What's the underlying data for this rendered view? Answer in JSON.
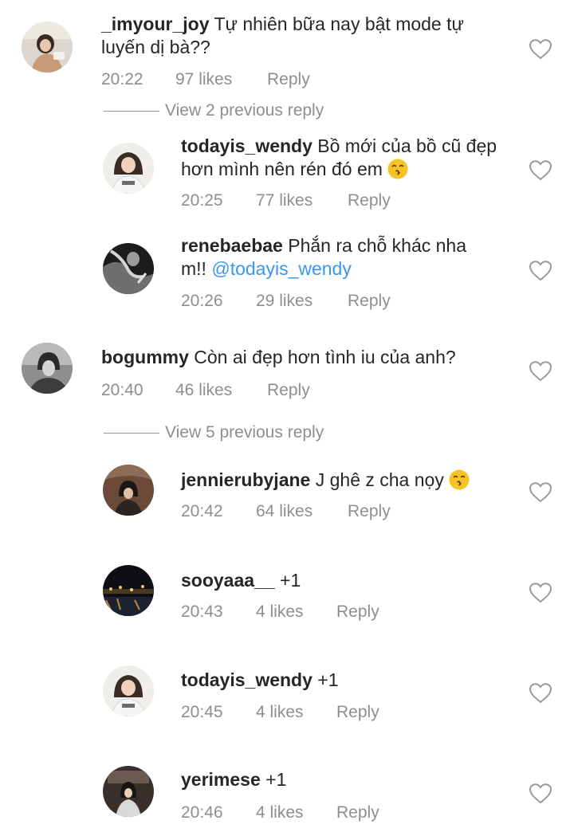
{
  "comments": [
    {
      "username": "_imyour_joy",
      "text": "Tự nhiên bữa nay bật mode tự",
      "text2": "luyến dị bà??",
      "time": "20:22",
      "likes": "97 likes",
      "reply": "Reply"
    },
    {
      "username": "bogummy",
      "text": "Còn ai đẹp hơn tình iu của anh?",
      "time": "20:40",
      "likes": "46 likes",
      "reply": "Reply"
    }
  ],
  "view_previous": [
    {
      "label": "View 2 previous reply"
    },
    {
      "label": "View 5 previous reply"
    }
  ],
  "replies": [
    {
      "username": "todayis_wendy",
      "text": "Bồ mới của bồ cũ đẹp",
      "text2": "hơn mình nên rén đó em",
      "emoji": "kissing-face",
      "time": "20:25",
      "likes": "77 likes",
      "reply": "Reply"
    },
    {
      "username": "renebaebae",
      "text": "Phắn ra chỗ khác nha",
      "text2": "m!!",
      "mention": "@todayis_wendy",
      "time": "20:26",
      "likes": "29 likes",
      "reply": "Reply"
    },
    {
      "username": "jennierubyjane",
      "text": "J ghê z cha nọy",
      "emoji": "kissing-face",
      "time": "20:42",
      "likes": "64 likes",
      "reply": "Reply"
    },
    {
      "username": "sooyaaa__",
      "text": "+1",
      "time": "20:43",
      "likes": "4 likes",
      "reply": "Reply"
    },
    {
      "username": "todayis_wendy",
      "text": "+1",
      "time": "20:45",
      "likes": "4 likes",
      "reply": "Reply"
    },
    {
      "username": "yerimese",
      "text": "+1",
      "time": "20:46",
      "likes": "4 likes",
      "reply": "Reply"
    }
  ],
  "icons": {
    "like": "heart-outline-icon",
    "emoji": "kissing-face-emoji"
  },
  "colors": {
    "text": "#262626",
    "muted": "#8e8e8e",
    "mention": "#3897f0",
    "emoji": "#f7c325"
  }
}
